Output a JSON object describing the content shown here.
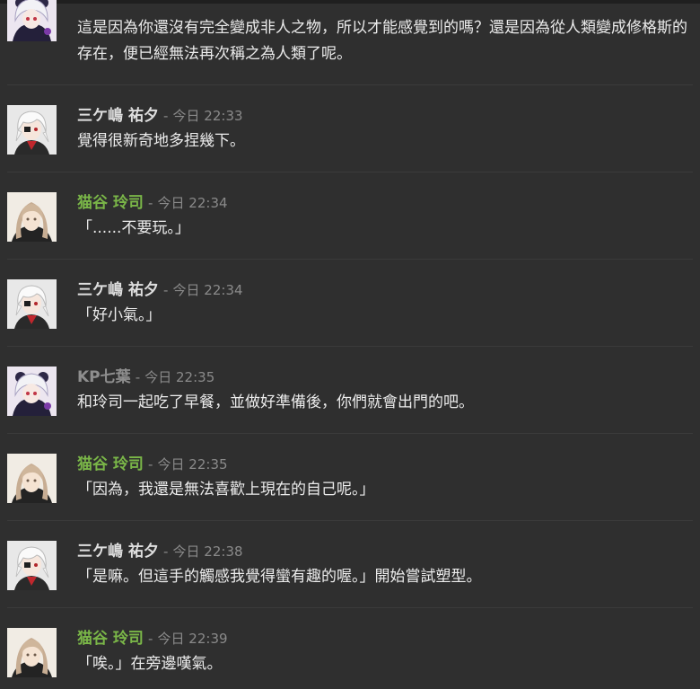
{
  "messages": [
    {
      "author": "",
      "author_color": "#bfbfbf",
      "time": "",
      "avatar": "kp",
      "text": "這是因為你還沒有完全變成非人之物，所以才能感覺到的嗎？還是因為從人類變成修格斯的存在，便已經無法再次稱之為人類了呢。"
    },
    {
      "author": "三ケ嶋 祐夕",
      "author_color": "#dedede",
      "time": "今日 22:33",
      "avatar": "yuu",
      "text": "覺得很新奇地多捏幾下。"
    },
    {
      "author": "猫谷 玲司",
      "author_color": "#7ab648",
      "time": "今日 22:34",
      "avatar": "reiji",
      "text": "「......不要玩。」"
    },
    {
      "author": "三ケ嶋 祐夕",
      "author_color": "#dedede",
      "time": "今日 22:34",
      "avatar": "yuu",
      "text": "「好小氣。」"
    },
    {
      "author": "KP七葉",
      "author_color": "#8e8e8e",
      "time": "今日 22:35",
      "avatar": "kp",
      "text": "和玲司一起吃了早餐，並做好準備後，你們就會出門的吧。"
    },
    {
      "author": "猫谷 玲司",
      "author_color": "#7ab648",
      "time": "今日 22:35",
      "avatar": "reiji",
      "text": "「因為，我還是無法喜歡上現在的自己呢。」"
    },
    {
      "author": "三ケ嶋 祐夕",
      "author_color": "#dedede",
      "time": "今日 22:38",
      "avatar": "yuu",
      "text": "「是嘛。但這手的觸感我覺得蠻有趣的喔。」開始嘗試塑型。"
    },
    {
      "author": "猫谷 玲司",
      "author_color": "#7ab648",
      "time": "今日 22:39",
      "avatar": "reiji",
      "text": "「唉。」在旁邊嘆氣。"
    }
  ],
  "separator": "-"
}
